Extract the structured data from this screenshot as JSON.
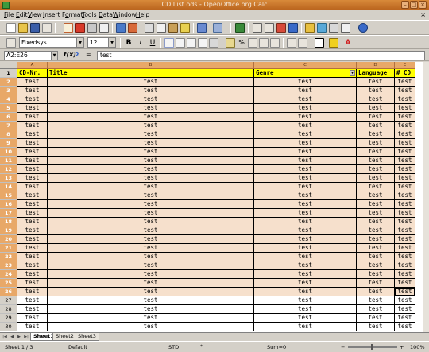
{
  "window": {
    "title": "CD List.ods - OpenOffice.org Calc"
  },
  "menu": [
    {
      "pre": "",
      "u": "F",
      "post": "ile"
    },
    {
      "pre": "",
      "u": "E",
      "post": "dit"
    },
    {
      "pre": "",
      "u": "V",
      "post": "iew"
    },
    {
      "pre": "",
      "u": "I",
      "post": "nsert"
    },
    {
      "pre": "F",
      "u": "o",
      "post": "rmat"
    },
    {
      "pre": "",
      "u": "T",
      "post": "ools"
    },
    {
      "pre": "",
      "u": "D",
      "post": "ata"
    },
    {
      "pre": "",
      "u": "W",
      "post": "indow"
    },
    {
      "pre": "",
      "u": "H",
      "post": "elp"
    }
  ],
  "formatting": {
    "font_name": "Fixedsys",
    "font_size": "12"
  },
  "formula": {
    "name_box": "A2:E26",
    "content": "test"
  },
  "columns": [
    {
      "letter": "A",
      "header": "CD-Nr."
    },
    {
      "letter": "B",
      "header": "Title"
    },
    {
      "letter": "C",
      "header": "Genre"
    },
    {
      "letter": "D",
      "header": "Language"
    },
    {
      "letter": "E",
      "header": "# CD"
    }
  ],
  "header_row": "1",
  "rows": [
    {
      "num": "2",
      "cells": [
        "test",
        "test",
        "test",
        "test",
        "test"
      ]
    },
    {
      "num": "3",
      "cells": [
        "test",
        "test",
        "test",
        "test",
        "test"
      ]
    },
    {
      "num": "4",
      "cells": [
        "test",
        "test",
        "test",
        "test",
        "test"
      ]
    },
    {
      "num": "5",
      "cells": [
        "test",
        "test",
        "test",
        "test",
        "test"
      ]
    },
    {
      "num": "6",
      "cells": [
        "test",
        "test",
        "test",
        "test",
        "test"
      ]
    },
    {
      "num": "7",
      "cells": [
        "test",
        "test",
        "test",
        "test",
        "test"
      ]
    },
    {
      "num": "8",
      "cells": [
        "test",
        "test",
        "test",
        "test",
        "test"
      ]
    },
    {
      "num": "9",
      "cells": [
        "test",
        "test",
        "test",
        "test",
        "test"
      ]
    },
    {
      "num": "10",
      "cells": [
        "test",
        "test",
        "test",
        "test",
        "test"
      ]
    },
    {
      "num": "11",
      "cells": [
        "test",
        "test",
        "test",
        "test",
        "test"
      ]
    },
    {
      "num": "12",
      "cells": [
        "test",
        "test",
        "test",
        "test",
        "test"
      ]
    },
    {
      "num": "13",
      "cells": [
        "test",
        "test",
        "test",
        "test",
        "test"
      ]
    },
    {
      "num": "14",
      "cells": [
        "test",
        "test",
        "test",
        "test",
        "test"
      ]
    },
    {
      "num": "15",
      "cells": [
        "test",
        "test",
        "test",
        "test",
        "test"
      ]
    },
    {
      "num": "16",
      "cells": [
        "test",
        "test",
        "test",
        "test",
        "test"
      ]
    },
    {
      "num": "17",
      "cells": [
        "test",
        "test",
        "test",
        "test",
        "test"
      ]
    },
    {
      "num": "18",
      "cells": [
        "test",
        "test",
        "test",
        "test",
        "test"
      ]
    },
    {
      "num": "19",
      "cells": [
        "test",
        "test",
        "test",
        "test",
        "test"
      ]
    },
    {
      "num": "20",
      "cells": [
        "test",
        "test",
        "test",
        "test",
        "test"
      ]
    },
    {
      "num": "21",
      "cells": [
        "test",
        "test",
        "test",
        "test",
        "test"
      ]
    },
    {
      "num": "22",
      "cells": [
        "test",
        "test",
        "test",
        "test",
        "test"
      ]
    },
    {
      "num": "23",
      "cells": [
        "test",
        "test",
        "test",
        "test",
        "test"
      ]
    },
    {
      "num": "24",
      "cells": [
        "test",
        "test",
        "test",
        "test",
        "test"
      ]
    },
    {
      "num": "25",
      "cells": [
        "test",
        "test",
        "test",
        "test",
        "test"
      ]
    },
    {
      "num": "26",
      "cells": [
        "test",
        "test",
        "test",
        "test",
        "test"
      ]
    },
    {
      "num": "27",
      "cells": [
        "test",
        "test",
        "test",
        "test",
        "test"
      ]
    },
    {
      "num": "28",
      "cells": [
        "test",
        "test",
        "test",
        "test",
        "test"
      ]
    },
    {
      "num": "29",
      "cells": [
        "test",
        "test",
        "test",
        "test",
        "test"
      ]
    },
    {
      "num": "30",
      "cells": [
        "test",
        "test",
        "test",
        "test",
        "test"
      ]
    }
  ],
  "selected_rows": [
    "2",
    "3",
    "4",
    "5",
    "6",
    "7",
    "8",
    "9",
    "10",
    "11",
    "12",
    "13",
    "14",
    "15",
    "16",
    "17",
    "18",
    "19",
    "20",
    "21",
    "22",
    "23",
    "24",
    "25",
    "26"
  ],
  "sheets": [
    "Sheet1",
    "Sheet2",
    "Sheet3"
  ],
  "active_sheet": "Sheet1",
  "status": {
    "sheet_pos": "Sheet 1 / 3",
    "page_style": "Default",
    "mode": "STD",
    "sum": "Sum=0",
    "zoom": "100%"
  },
  "colors": {
    "title_bar": "#c8732a",
    "selection": "#f6e0cc",
    "header_fill": "#ffff00",
    "col_header": "#e8a868"
  },
  "icons": [
    "new-icon",
    "open-icon",
    "save-icon",
    "email-icon",
    "edit-file-icon",
    "export-pdf-icon",
    "print-icon",
    "page-preview-icon",
    "spellcheck-icon",
    "autospell-icon",
    "cut-icon",
    "copy-icon",
    "paste-icon",
    "clone-icon",
    "undo-icon",
    "redo-icon",
    "hyperlink-icon",
    "sort-ascending-icon",
    "sort-descending-icon",
    "chart-icon",
    "draw-icon",
    "navigator-icon",
    "gallery-icon",
    "data-sources-icon",
    "zoom-icon",
    "help-icon"
  ]
}
